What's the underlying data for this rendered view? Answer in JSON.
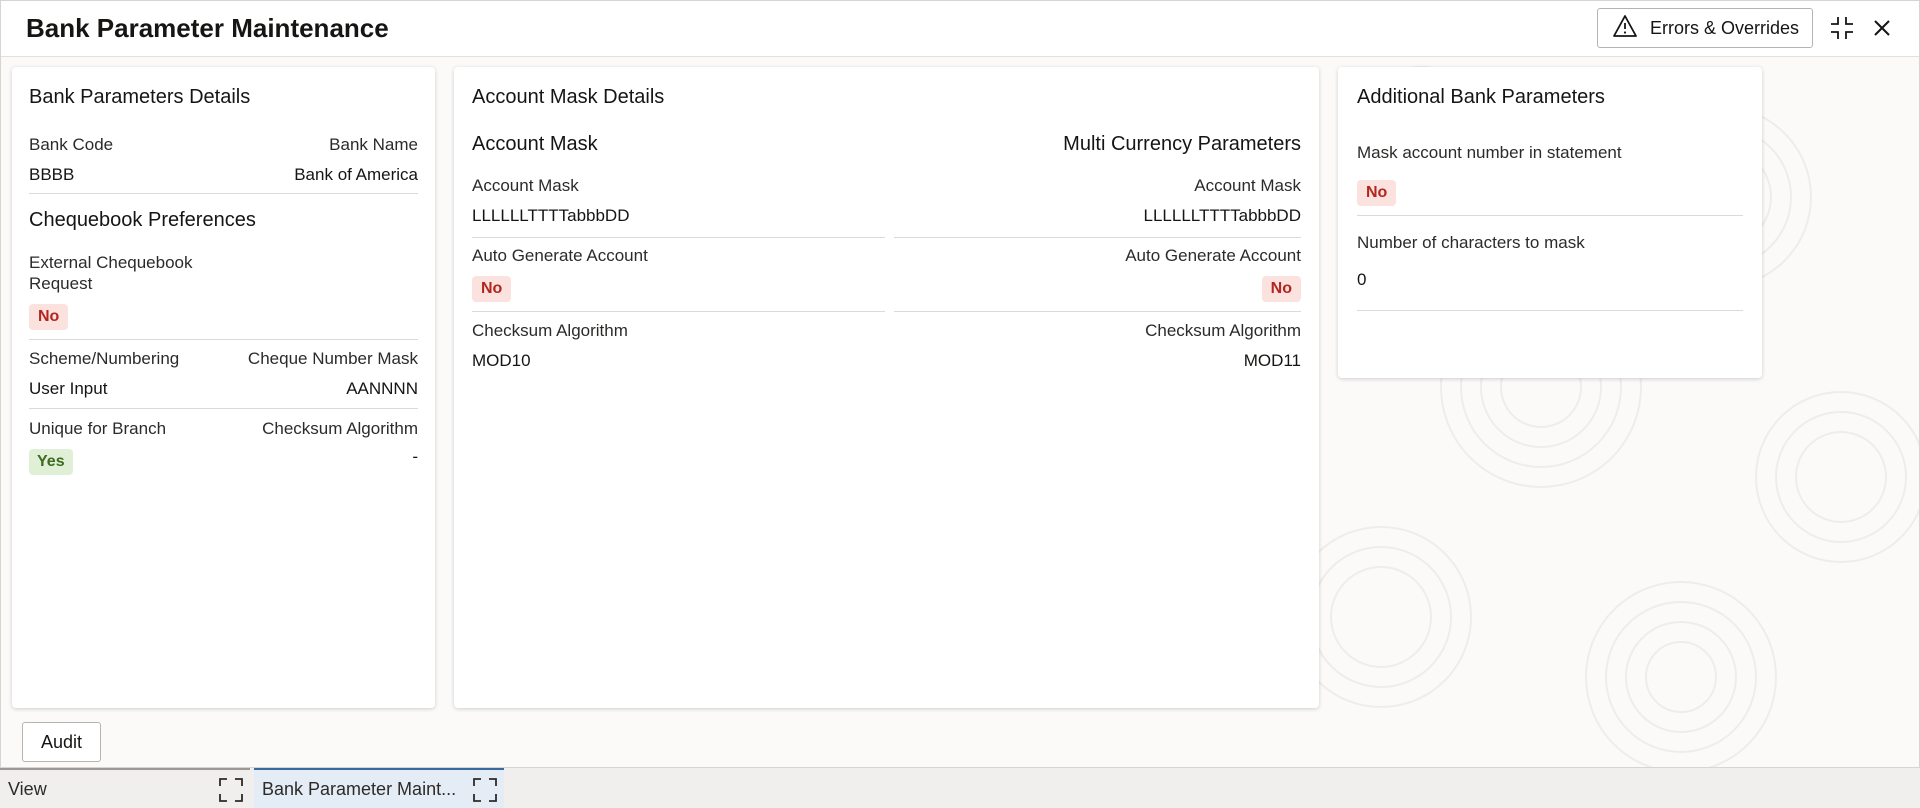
{
  "header": {
    "title": "Bank Parameter Maintenance",
    "errors_label": "Errors & Overrides"
  },
  "bank_params": {
    "title": "Bank Parameters Details",
    "bank_code_label": "Bank Code",
    "bank_code_value": "BBBB",
    "bank_name_label": "Bank Name",
    "bank_name_value": "Bank of America",
    "cheque_title": "Chequebook Preferences",
    "ext_cheque_label_1": "External Chequebook",
    "ext_cheque_label_2": "Request",
    "ext_cheque_value": "No",
    "scheme_label": "Scheme/Numbering",
    "scheme_value": "User Input",
    "cheque_mask_label": "Cheque Number Mask",
    "cheque_mask_value": "AANNNN",
    "unique_label": "Unique for Branch",
    "unique_value": "Yes",
    "checksum_label": "Checksum Algorithm",
    "checksum_value": "-"
  },
  "account_mask": {
    "title": "Account Mask Details",
    "left": {
      "title": "Account Mask",
      "mask_label": "Account Mask",
      "mask_value": "LLLLLLTTTTabbbDD",
      "auto_label": "Auto Generate Account",
      "auto_value": "No",
      "checksum_label": "Checksum Algorithm",
      "checksum_value": "MOD10"
    },
    "right": {
      "title": "Multi Currency Parameters",
      "mask_label": "Account Mask",
      "mask_value": "LLLLLLTTTTabbbDD",
      "auto_label": "Auto Generate Account",
      "auto_value": "No",
      "checksum_label": "Checksum Algorithm",
      "checksum_value": "MOD11"
    }
  },
  "additional": {
    "title": "Additional Bank Parameters",
    "mask_stmt_label": "Mask account number in statement",
    "mask_stmt_value": "No",
    "num_chars_label": "Number of characters to mask",
    "num_chars_value": "0"
  },
  "footer": {
    "audit_label": "Audit"
  },
  "taskbar": {
    "tabs": [
      {
        "label": "View"
      },
      {
        "label": "Bank Parameter Maint..."
      }
    ]
  },
  "icons": {
    "warning": "warning-icon",
    "minimize": "minimize-icon",
    "close": "close-icon",
    "expand": "expand-icon"
  }
}
